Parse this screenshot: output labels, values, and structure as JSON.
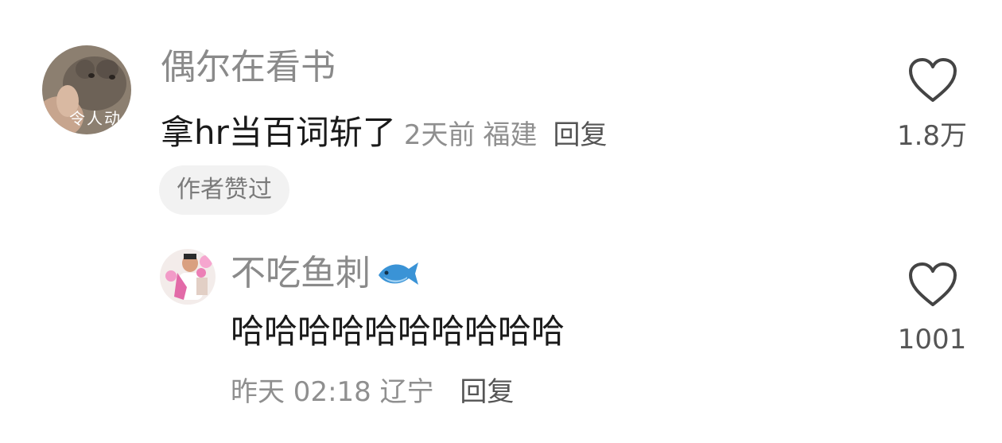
{
  "comments": [
    {
      "username": "偶尔在看书",
      "avatar_caption": "令人动",
      "content": "拿hr当百词斩了",
      "time": "2天前",
      "location": "福建",
      "reply_label": "回复",
      "badge": "作者赞过",
      "likes": "1.8万"
    }
  ],
  "replies": [
    {
      "username": "不吃鱼刺",
      "username_icon": "fish-icon",
      "content": "哈哈哈哈哈哈哈哈哈哈",
      "time": "昨天 02:18",
      "location": "辽宁",
      "reply_label": "回复",
      "likes": "1001"
    }
  ],
  "colors": {
    "username": "#8a8a8a",
    "content": "#1a1a1a",
    "meta": "#8f8f8f",
    "badge_bg": "#f2f2f2",
    "heart_stroke": "#444444"
  }
}
